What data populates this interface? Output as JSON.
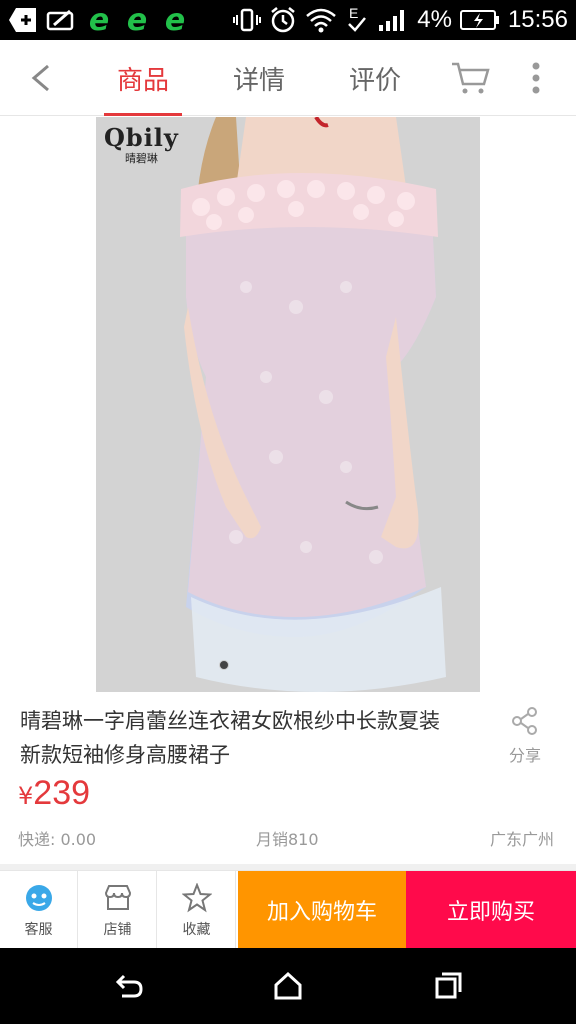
{
  "status_bar": {
    "battery": "4%",
    "time": "15:56",
    "icons": [
      "add-icon",
      "sms-icon",
      "browser-e-icon",
      "browser-e-icon",
      "browser-e-icon",
      "vibrate-icon",
      "alarm-icon",
      "wifi-icon",
      "data-e-icon",
      "signal-icon",
      "battery-charging-icon"
    ]
  },
  "top_nav": {
    "tabs": [
      {
        "label": "商品",
        "active": true
      },
      {
        "label": "详情",
        "active": false
      },
      {
        "label": "评价",
        "active": false
      }
    ]
  },
  "product_image": {
    "brand": "Qbily",
    "brand_sub": "晴碧琳",
    "slide_count": 1
  },
  "product": {
    "title": "晴碧琳一字肩蕾丝连衣裙女欧根纱中长款夏装新款短袖修身高腰裙子",
    "currency": "¥",
    "price": "239",
    "shipping": "快递: 0.00",
    "monthly_sales": "月销810",
    "location": "广东广州",
    "share_label": "分享"
  },
  "bottom_bar": {
    "service_label": "客服",
    "shop_label": "店铺",
    "favorite_label": "收藏",
    "add_to_cart_label": "加入购物车",
    "buy_now_label": "立即购买"
  },
  "colors": {
    "accent": "#e4393c",
    "add_to_cart_bg": "#ff9500",
    "buy_now_bg": "#ff0a4b"
  }
}
